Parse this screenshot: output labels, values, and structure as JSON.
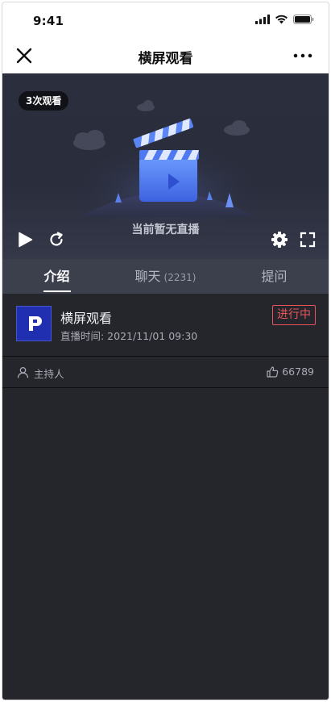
{
  "status_bar": {
    "time": "9:41"
  },
  "nav": {
    "title": "横屏观看",
    "close_icon": "close-icon",
    "more_icon": "more-icon"
  },
  "video": {
    "view_badge": "3次观看",
    "placeholder_text": "当前暂无直播"
  },
  "tabs": [
    {
      "label": "介绍",
      "count": "",
      "active": true
    },
    {
      "label": "聊天",
      "count": "(2231)",
      "active": false
    },
    {
      "label": "提问",
      "count": "",
      "active": false
    }
  ],
  "info": {
    "title": "横屏观看",
    "time": "直播时间: 2021/11/01 09:30",
    "status": "进行中"
  },
  "host": {
    "label": "主持人",
    "likes": "66789"
  },
  "colors": {
    "accent_red": "#e8545a",
    "logo_blue": "#1f2fb0",
    "tabs_bg": "#3c3f4c",
    "content_bg": "#25262c"
  }
}
